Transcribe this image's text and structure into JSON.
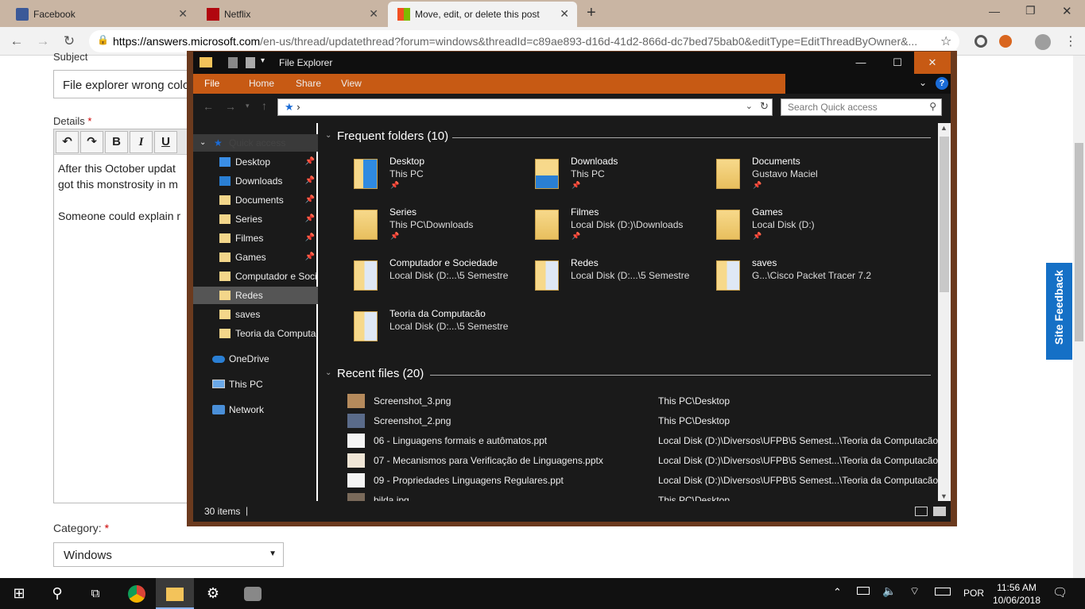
{
  "browser": {
    "tabs": [
      {
        "label": "Facebook",
        "icon": "facebook-icon"
      },
      {
        "label": "Netflix",
        "icon": "netflix-icon"
      },
      {
        "label": "Move, edit, or delete this post",
        "icon": "microsoft-icon"
      }
    ],
    "url_domain": "https://answers.microsoft.com",
    "url_rest": "/en-us/thread/updatethread?forum=windows&threadId=c89ae893-d16d-41d2-866d-dc7bed75bab0&editType=EditThreadByOwner&..."
  },
  "page": {
    "subject_label": "Subject",
    "subject_value": "File explorer wrong colo",
    "details_label": "Details",
    "required": "*",
    "toolbar": {
      "bold": "B",
      "italic": "I",
      "underline": "U"
    },
    "details_text_1": "After this October updat",
    "details_text_2": "got this monstrosity in m",
    "details_text_3": "Someone could explain r",
    "category_label": "Category:",
    "category_value": "Windows",
    "feedback": "Site Feedback"
  },
  "explorer": {
    "title": "File Explorer",
    "ribbon": [
      "File",
      "Home",
      "Share",
      "View"
    ],
    "crumb": "›",
    "search_placeholder": "Search Quick access",
    "nav": {
      "quick_access": "Quick access",
      "pinned": [
        {
          "label": "Desktop",
          "pin": true
        },
        {
          "label": "Downloads",
          "pin": true
        },
        {
          "label": "Documents",
          "pin": true
        },
        {
          "label": "Series",
          "pin": true
        },
        {
          "label": "Filmes",
          "pin": true
        },
        {
          "label": "Games",
          "pin": true
        },
        {
          "label": "Computador e Soci",
          "pin": false
        },
        {
          "label": "Redes",
          "pin": false
        },
        {
          "label": "saves",
          "pin": false
        },
        {
          "label": "Teoria da Computac",
          "pin": false
        }
      ],
      "onedrive": "OneDrive",
      "thispc": "This PC",
      "network": "Network"
    },
    "frequent_title": "Frequent folders (10)",
    "folders": [
      {
        "name": "Desktop",
        "path": "This PC",
        "pin": true
      },
      {
        "name": "Downloads",
        "path": "This PC",
        "pin": true
      },
      {
        "name": "Documents",
        "path": "Gustavo Maciel",
        "pin": true
      },
      {
        "name": "Series",
        "path": "This PC\\Downloads",
        "pin": true
      },
      {
        "name": "Filmes",
        "path": "Local Disk (D:)\\Downloads",
        "pin": true
      },
      {
        "name": "Games",
        "path": "Local Disk (D:)",
        "pin": true
      },
      {
        "name": "Computador e Sociedade",
        "path": "Local Disk (D:...\\5 Semestre",
        "pin": false
      },
      {
        "name": "Redes",
        "path": "Local Disk (D:...\\5 Semestre",
        "pin": false
      },
      {
        "name": "saves",
        "path": "G...\\Cisco Packet Tracer 7.2",
        "pin": false
      },
      {
        "name": "Teoria da Computacão",
        "path": "Local Disk (D:...\\5 Semestre",
        "pin": false
      }
    ],
    "recent_title": "Recent files (20)",
    "files": [
      {
        "name": "Screenshot_3.png",
        "loc": "This PC\\Desktop"
      },
      {
        "name": "Screenshot_2.png",
        "loc": "This PC\\Desktop"
      },
      {
        "name": "06 - Linguagens formais e autômatos.ppt",
        "loc": "Local Disk (D:)\\Diversos\\UFPB\\5 Semest...\\Teoria da Computacão"
      },
      {
        "name": "07 - Mecanismos para Verificação de Linguagens.pptx",
        "loc": "Local Disk (D:)\\Diversos\\UFPB\\5 Semest...\\Teoria da Computacão"
      },
      {
        "name": "09 -  Propriedades Linguagens  Regulares.ppt",
        "loc": "Local Disk (D:)\\Diversos\\UFPB\\5 Semest...\\Teoria da Computacão"
      },
      {
        "name": "bilda.jpg",
        "loc": "This PC\\Desktop"
      }
    ],
    "status": "30 items"
  },
  "taskbar": {
    "time": "11:56 AM",
    "date": "10/06/2018",
    "lang": "POR"
  },
  "colors": {
    "accent": "#c75a14",
    "frame": "#6b3a1e",
    "dark": "#1a1a1a",
    "feedback": "#1570c6"
  }
}
